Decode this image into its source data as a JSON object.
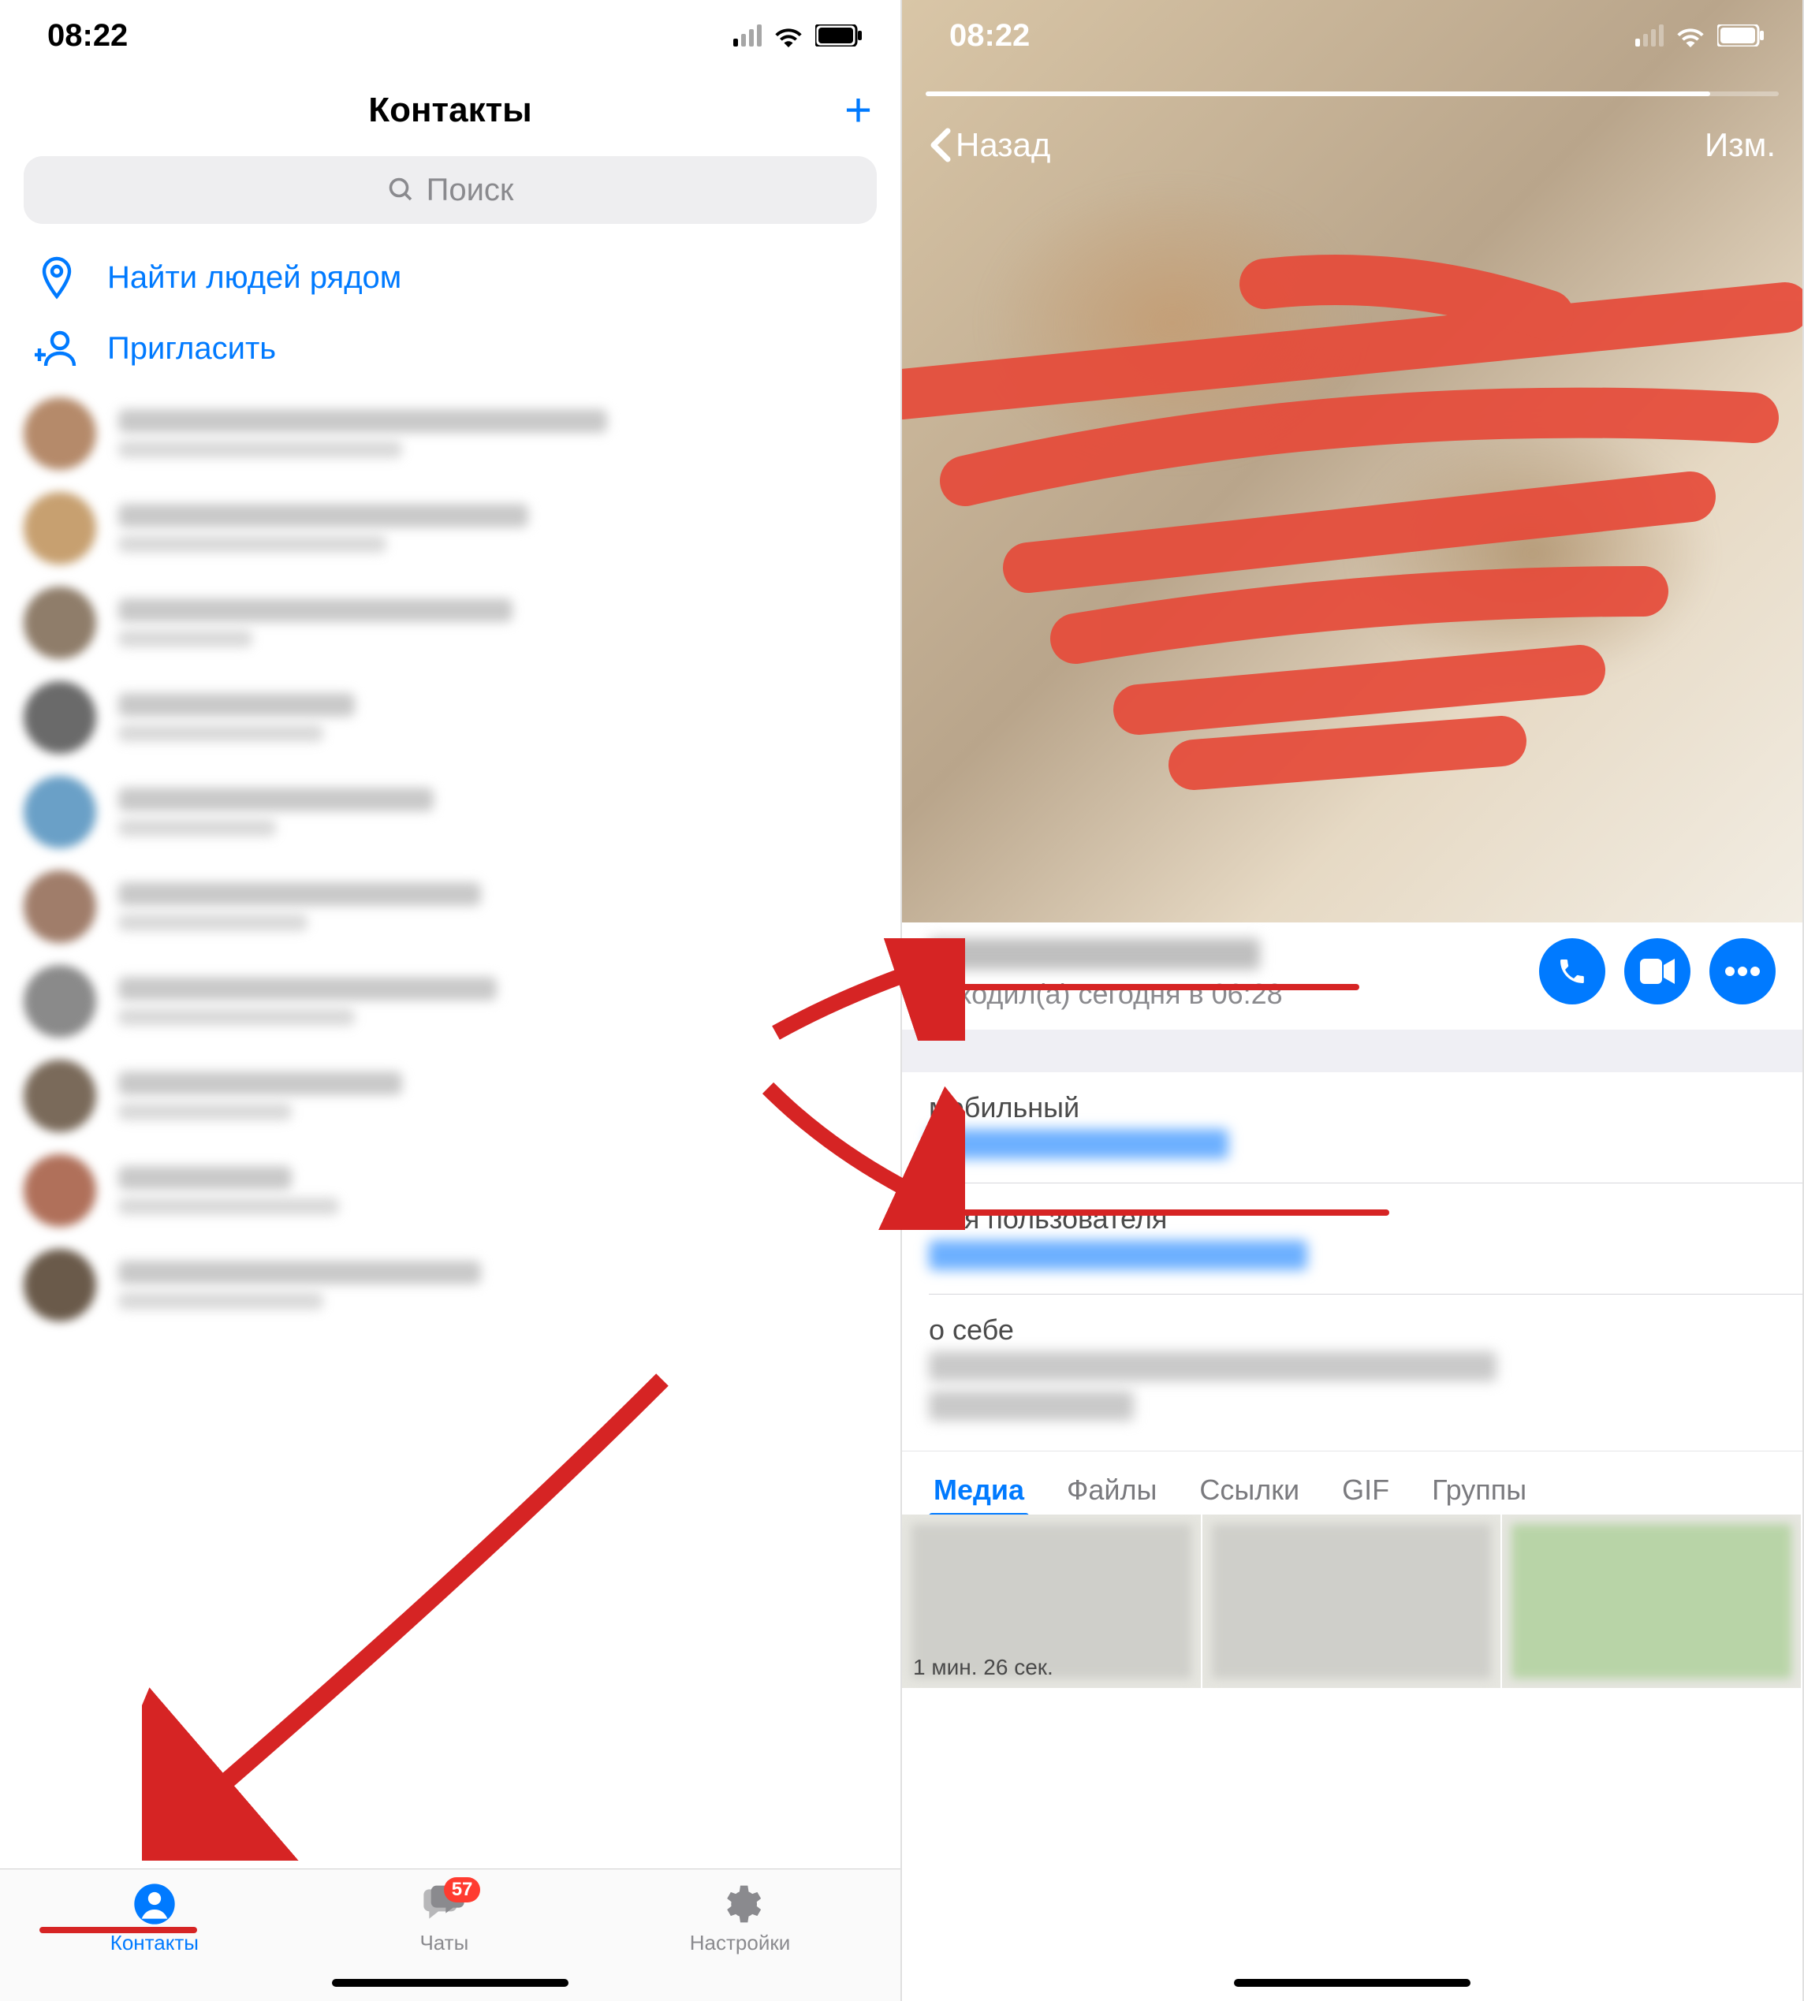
{
  "status": {
    "time": "08:22"
  },
  "left": {
    "title": "Контакты",
    "search_placeholder": "Поиск",
    "actions": {
      "nearby": "Найти людей рядом",
      "invite": "Пригласить"
    },
    "contacts": [
      {
        "name_w": 620,
        "sub_w": 360
      },
      {
        "name_w": 520,
        "sub_w": 340
      },
      {
        "name_w": 500,
        "sub_w": 170
      },
      {
        "name_w": 300,
        "sub_w": 260
      },
      {
        "name_w": 400,
        "sub_w": 200
      },
      {
        "name_w": 460,
        "sub_w": 240
      },
      {
        "name_w": 480,
        "sub_w": 300
      },
      {
        "name_w": 360,
        "sub_w": 220
      },
      {
        "name_w": 220,
        "sub_w": 280
      },
      {
        "name_w": 460,
        "sub_w": 260
      }
    ],
    "tabs": {
      "contacts": "Контакты",
      "chats": "Чаты",
      "settings": "Настройки",
      "badge": "57"
    }
  },
  "right": {
    "back": "Назад",
    "edit": "Изм.",
    "presence": "заходил(а) сегодня в 06:28",
    "info": {
      "mobile_label": "мобильный",
      "username_label": "имя пользователя",
      "about_label": "о себе"
    },
    "media_tabs": {
      "media": "Медиа",
      "files": "Файлы",
      "links": "Ссылки",
      "gif": "GIF",
      "groups": "Группы"
    },
    "media_caption": "1 мин. 26 сек."
  }
}
